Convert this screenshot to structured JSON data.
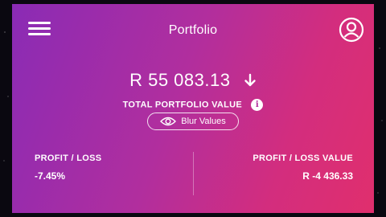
{
  "header": {
    "title": "Portfolio",
    "menu_icon": "hamburger-menu-icon",
    "profile_icon": "user-profile-icon"
  },
  "portfolio": {
    "total_value": "R 55 083.13",
    "trend_icon": "arrow-down-icon",
    "total_label": "TOTAL PORTFOLIO VALUE",
    "info_icon": "info-icon",
    "info_glyph": "i"
  },
  "blur_toggle": {
    "label": "Blur Values",
    "icon": "eye-icon"
  },
  "stats": {
    "profit_loss_label": "PROFIT / LOSS",
    "profit_loss_value": "-7.45%",
    "profit_loss_value_label": "PROFIT / LOSS VALUE",
    "profit_loss_value_amount": "R -4 436.33"
  },
  "colors": {
    "gradient_start": "#8a2bb5",
    "gradient_end": "#e02f6d",
    "text": "#ffffff"
  }
}
